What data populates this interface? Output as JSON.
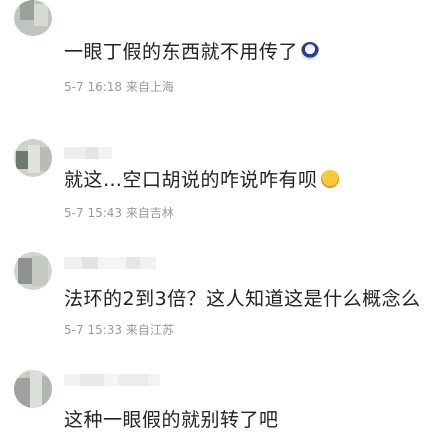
{
  "comments": [
    {
      "text": "一眼丁假的东西就不用传了",
      "emoji": "face-emoji",
      "date": "5-7",
      "time": "16:18",
      "location": "来自上海"
    },
    {
      "text": "就这…空口胡说的咋说咋有呗",
      "emoji": "smile-emoji",
      "date": "5-7",
      "time": "15:43",
      "location": "来自吉林"
    },
    {
      "text": "法环的2到3倍？这人知道这是什么概念么",
      "date": "5-7",
      "time": "15:33",
      "location": "来自江苏"
    },
    {
      "text": "这种一眼假的就别转了吧"
    }
  ],
  "colors": {
    "text": "#222222",
    "meta": "#9a9a9a",
    "background": "#ffffff"
  }
}
